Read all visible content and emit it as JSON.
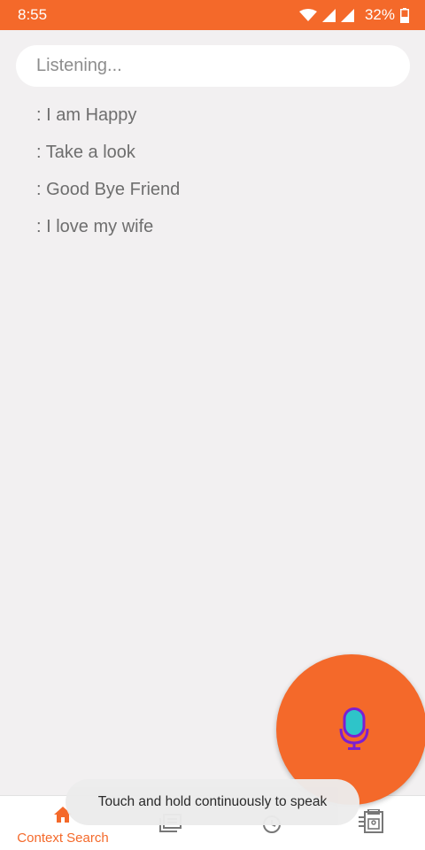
{
  "status_bar": {
    "time": "8:55",
    "battery_percent": "32%",
    "icons": [
      "wifi-icon",
      "signal-icon",
      "signal-icon",
      "battery-icon"
    ]
  },
  "search": {
    "placeholder": "Listening..."
  },
  "phrases": [
    {
      "text": ": I am Happy"
    },
    {
      "text": ": Take a look"
    },
    {
      "text": ": Good Bye Friend"
    },
    {
      "text": ": I love my wife"
    }
  ],
  "mic_button": {
    "icon": "microphone-icon"
  },
  "toast": {
    "text": "Touch and hold continuously to speak"
  },
  "bottom_nav": {
    "items": [
      {
        "label": "Context Search",
        "icon": "home-icon",
        "active": true
      },
      {
        "label": "",
        "icon": "library-icon",
        "active": false
      },
      {
        "label": "",
        "icon": "history-icon",
        "active": false
      },
      {
        "label": "",
        "icon": "gallery-icon",
        "active": false
      }
    ]
  },
  "colors": {
    "accent": "#f4692a",
    "background": "#f2f0f1",
    "mic_fill": "#2ec4c9",
    "mic_outline": "#7b1fd1"
  }
}
